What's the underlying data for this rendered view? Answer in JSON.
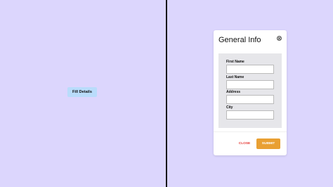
{
  "left_pane": {
    "fill_button_label": "Fill Details"
  },
  "modal": {
    "title": "General Info",
    "close_icon": "close-icon",
    "fields": [
      {
        "label": "First Name",
        "value": "",
        "placeholder": ""
      },
      {
        "label": "Last Name",
        "value": "",
        "placeholder": ""
      },
      {
        "label": "Address",
        "value": "",
        "placeholder": ""
      },
      {
        "label": "City",
        "value": "",
        "placeholder": ""
      }
    ],
    "close_label": "CLOSE",
    "submit_label": "SUBMIT"
  },
  "colors": {
    "background": "#dcd6fd",
    "divider": "#151515",
    "fill_button": "#b9dcfb",
    "form_panel": "#e6e6ea",
    "close_text": "#e53935",
    "submit_button": "#e9a033"
  }
}
